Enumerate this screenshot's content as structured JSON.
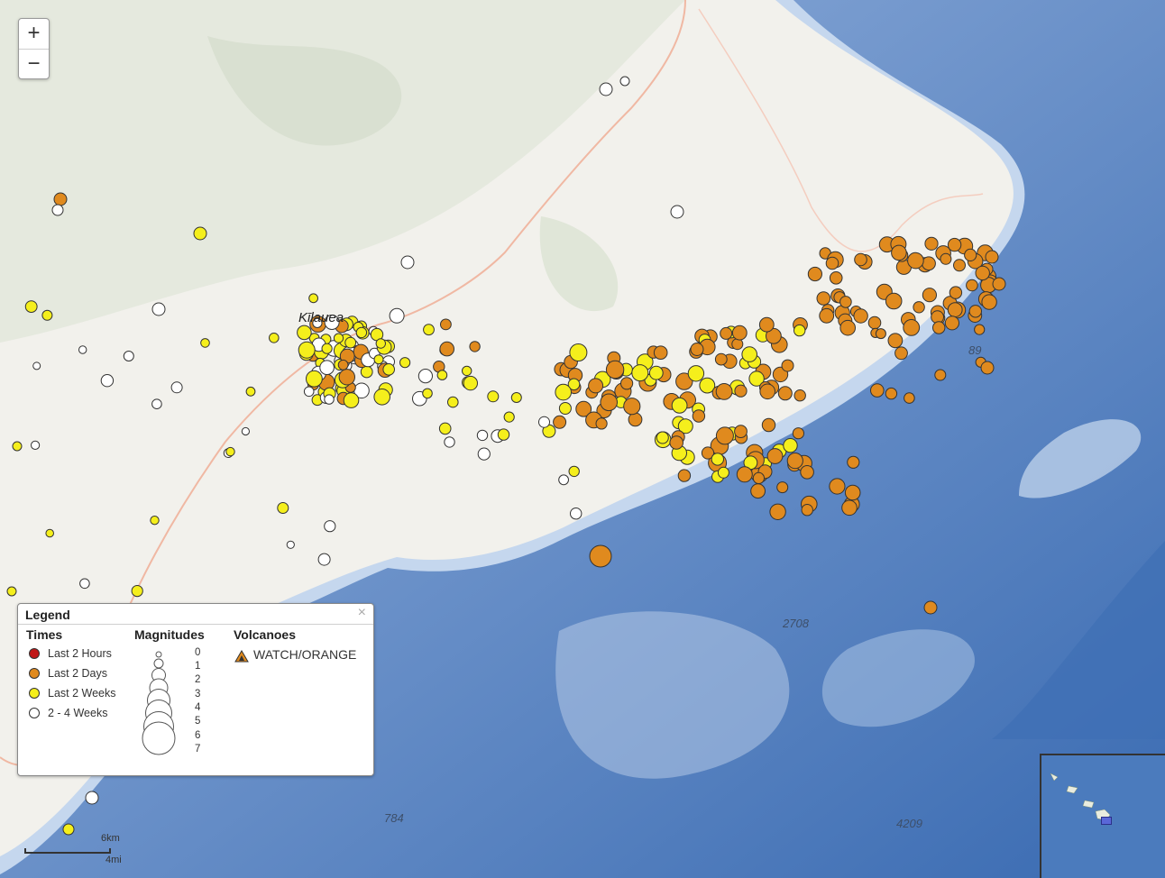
{
  "map": {
    "zoom_in_label": "+",
    "zoom_out_label": "−",
    "place_label": "Kīlauea",
    "depth_labels": [
      "89",
      "2708",
      "784",
      "4209"
    ],
    "scale": {
      "km_label": "6km",
      "mi_label": "4mi"
    }
  },
  "legend": {
    "title": "Legend",
    "close_label": "×",
    "times_heading": "Times",
    "times": [
      {
        "label": "Last 2 Hours",
        "color": "#c01818"
      },
      {
        "label": "Last 2 Days",
        "color": "#e08a1e"
      },
      {
        "label": "Last 2 Weeks",
        "color": "#f5ef1c"
      },
      {
        "label": "2 - 4 Weeks",
        "color": "#ffffff"
      }
    ],
    "magnitudes_heading": "Magnitudes",
    "magnitudes": [
      "0",
      "1",
      "2",
      "3",
      "4",
      "5",
      "6",
      "7"
    ],
    "volcanoes_heading": "Volcanoes",
    "volcano_status": "WATCH/ORANGE"
  },
  "colors": {
    "ocean_deep": "#3c6fb6",
    "ocean_shelf": "#aac3e4",
    "land": "#f2f1ec",
    "vegetation": "#dfe5d8",
    "road": "#f0b8a3"
  }
}
